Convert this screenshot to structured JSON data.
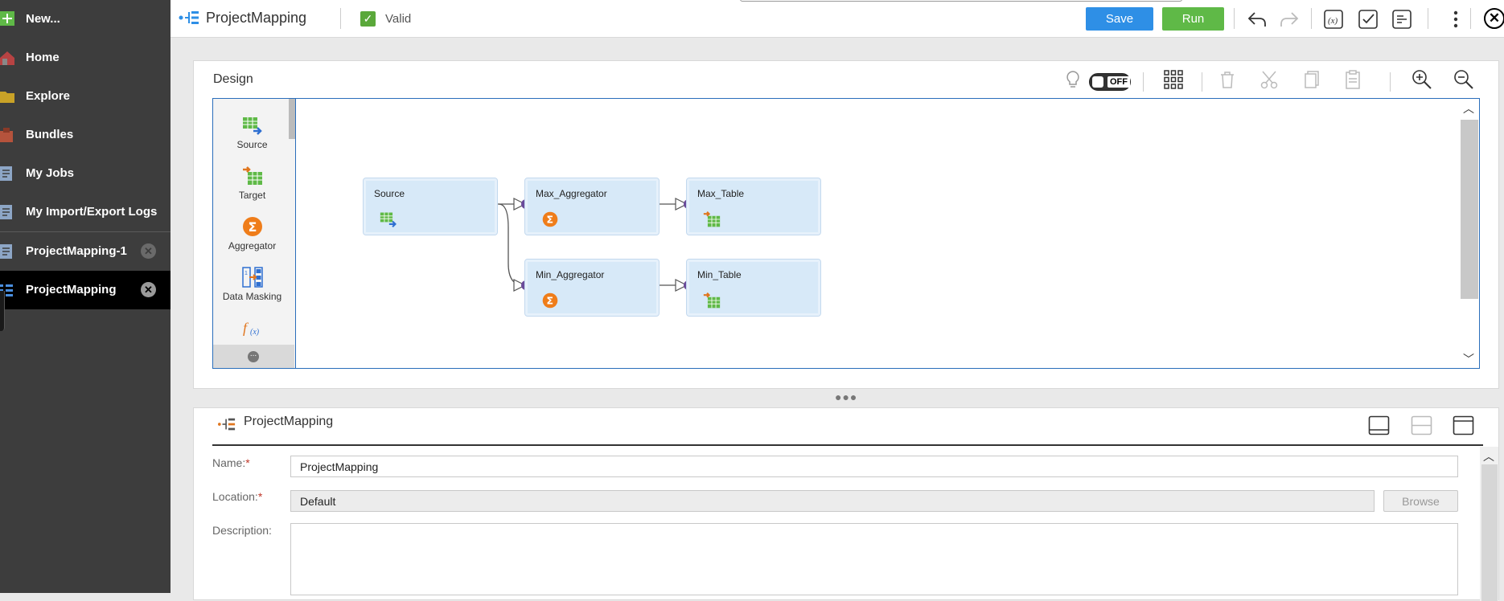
{
  "sidebar": {
    "items": [
      {
        "label": "New...",
        "icon": "plus-icon"
      },
      {
        "label": "Home",
        "icon": "home-icon"
      },
      {
        "label": "Explore",
        "icon": "folder-icon"
      },
      {
        "label": "Bundles",
        "icon": "bundle-icon"
      },
      {
        "label": "My Jobs",
        "icon": "document-icon"
      },
      {
        "label": "My Import/Export Logs",
        "icon": "document-icon"
      }
    ],
    "tabs": [
      {
        "label": "ProjectMapping-1",
        "icon": "mapping-icon",
        "active": false
      },
      {
        "label": "ProjectMapping",
        "icon": "mapping-icon",
        "active": true
      }
    ]
  },
  "topbar": {
    "title": "ProjectMapping",
    "status": "Valid",
    "save_label": "Save",
    "run_label": "Run",
    "colors": {
      "save": "#2e8fe6",
      "run": "#5fb947",
      "valid": "#5aa83a"
    }
  },
  "design": {
    "title": "Design",
    "toggle_label": "OFF",
    "palette": [
      {
        "label": "Source",
        "icon": "source-icon"
      },
      {
        "label": "Target",
        "icon": "target-icon"
      },
      {
        "label": "Aggregator",
        "icon": "aggregator-icon"
      },
      {
        "label": "Data Masking",
        "icon": "data-masking-icon"
      },
      {
        "label": "",
        "icon": "expression-icon"
      }
    ],
    "nodes": [
      {
        "id": "source",
        "label": "Source",
        "icon": "source-icon"
      },
      {
        "id": "max_agg",
        "label": "Max_Aggregator",
        "icon": "aggregator-icon"
      },
      {
        "id": "max_table",
        "label": "Max_Table",
        "icon": "target-icon"
      },
      {
        "id": "min_agg",
        "label": "Min_Aggregator",
        "icon": "aggregator-icon"
      },
      {
        "id": "min_table",
        "label": "Min_Table",
        "icon": "target-icon"
      }
    ],
    "links": [
      {
        "from": "Source",
        "to": "Max_Aggregator"
      },
      {
        "from": "Source",
        "to": "Min_Aggregator"
      },
      {
        "from": "Max_Aggregator",
        "to": "Max_Table"
      },
      {
        "from": "Min_Aggregator",
        "to": "Min_Table"
      }
    ]
  },
  "properties": {
    "title": "ProjectMapping",
    "name_label": "Name:",
    "name_value": "ProjectMapping",
    "location_label": "Location:",
    "location_value": "Default",
    "browse_label": "Browse",
    "description_label": "Description:",
    "required_mark": "*"
  }
}
